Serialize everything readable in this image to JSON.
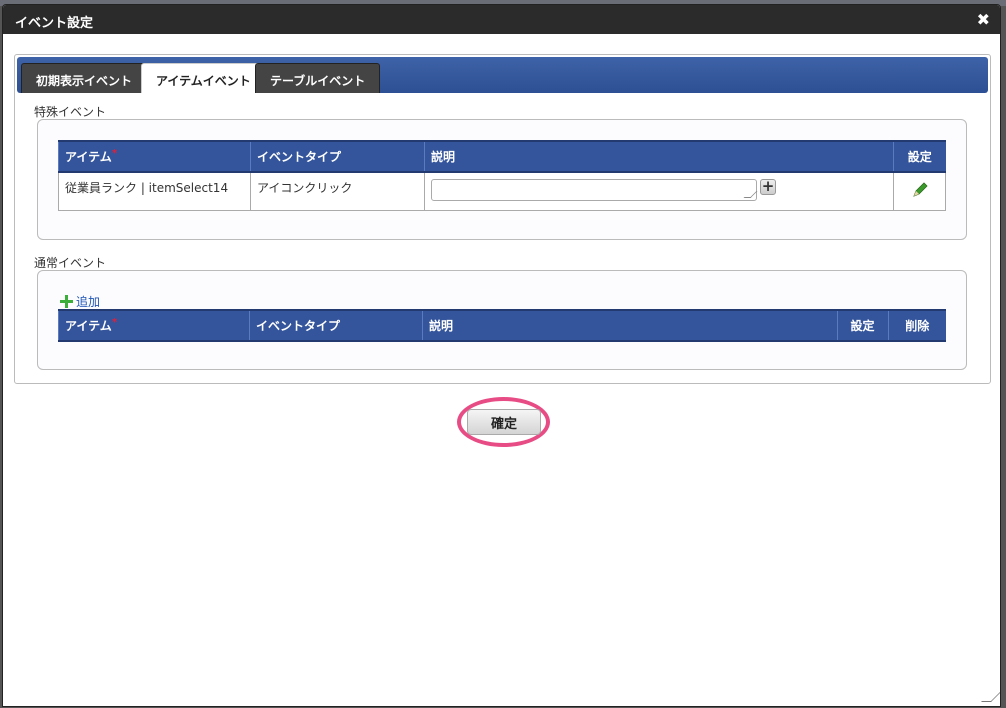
{
  "dialog": {
    "title": "イベント設定",
    "close_icon": "close-icon"
  },
  "tabs": [
    {
      "label": "初期表示イベント"
    },
    {
      "label": "アイテムイベント",
      "active": true
    },
    {
      "label": "テーブルイベント"
    }
  ],
  "special": {
    "label": "特殊イベント",
    "headers": {
      "item": "アイテム",
      "required": "*",
      "event_type": "イベントタイプ",
      "description": "説明",
      "settings": "設定"
    },
    "rows": [
      {
        "item": "従業員ランク | itemSelect14",
        "event_type": "アイコンクリック",
        "description": ""
      }
    ]
  },
  "normal": {
    "label": "通常イベント",
    "add_label": "追加",
    "headers": {
      "item": "アイテム",
      "required": "*",
      "event_type": "イベントタイプ",
      "description": "説明",
      "settings": "設定",
      "delete": "削除"
    }
  },
  "confirm_label": "確定",
  "colors": {
    "header": "#34559b",
    "highlight": "#e84c85",
    "titlebar": "#2b2b2b"
  }
}
